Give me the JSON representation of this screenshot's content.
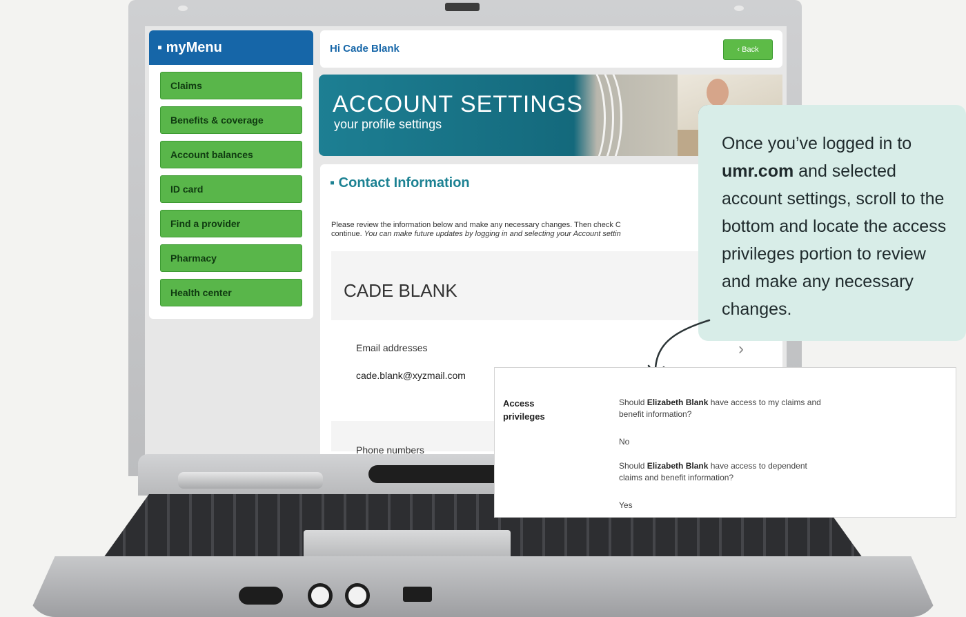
{
  "menu": {
    "title": "myMenu",
    "items": [
      "Claims",
      "Benefits & coverage",
      "Account balances",
      "ID card",
      "Find a provider",
      "Pharmacy",
      "Health center"
    ]
  },
  "header": {
    "greeting": "Hi Cade Blank",
    "back_label": "Back"
  },
  "banner": {
    "title": "ACCOUNT SETTINGS",
    "subtitle": "your profile settings"
  },
  "contact": {
    "title": "Contact Information",
    "desc_line1": "Please review the information below and make any necessary changes. Then check C",
    "desc_line2_plain": "continue. ",
    "desc_line2_italic": "You can make future updates by logging in and selecting your Account settin",
    "name": "CADE BLANK",
    "email_label": "Email addresses",
    "email_value": "cade.blank@xyzmail.com",
    "phone_label": "Phone numbers"
  },
  "callout": {
    "text_before": "Once you’ve logged in to ",
    "bold": "umr.com",
    "text_after": " and selected account settings, scroll to the bottom and locate the access privileges portion to review and make any necessary changes."
  },
  "access": {
    "label": "Access privileges",
    "q1_before": "Should ",
    "q1_name": "Elizabeth Blank",
    "q1_after": " have access to my claims and benefit information?",
    "a1": "No",
    "q2_before": "Should ",
    "q2_name": "Elizabeth Blank",
    "q2_after": " have access to dependent claims and benefit information?",
    "a2": "Yes"
  },
  "colors": {
    "menu_blue": "#1666a8",
    "menu_green": "#59b64a",
    "banner_teal": "#1d7f93",
    "callout_bg": "#d8ede8"
  }
}
